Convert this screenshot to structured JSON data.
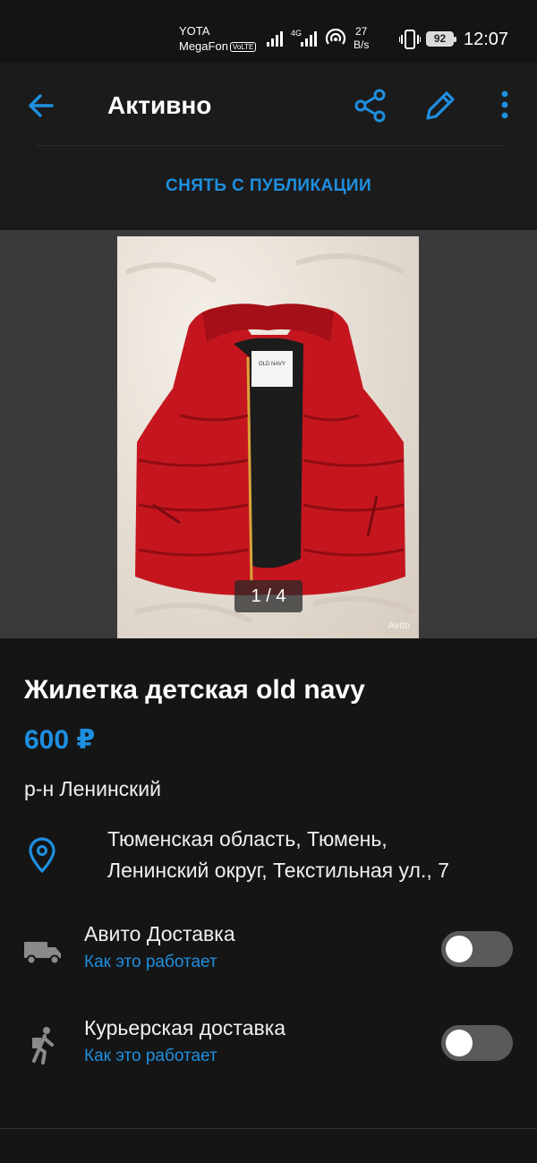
{
  "status_bar": {
    "carrier1": "YOTA",
    "carrier2": "MegaFon",
    "volte": "VoLTE",
    "network_type": "4G",
    "speed_value": "27",
    "speed_unit": "B/s",
    "battery": "92",
    "time": "12:07"
  },
  "toolbar": {
    "title": "Активно",
    "back_icon": "arrow-left-icon",
    "share_icon": "share-icon",
    "edit_icon": "pencil-icon",
    "more_icon": "more-vert-icon"
  },
  "unpublish_button": "СНЯТЬ С ПУБЛИКАЦИИ",
  "gallery": {
    "counter": "1 / 4",
    "watermark": "Avito",
    "tag_text": "OLD NAVY"
  },
  "listing": {
    "title": "Жилетка детская old navy",
    "price": "600 ₽",
    "district": "р-н Ленинский",
    "address_line1": "Тюменская область, Тюмень,",
    "address_line2": "Ленинский округ, Текстильная ул., 7"
  },
  "delivery": [
    {
      "title": "Авито Доставка",
      "link": "Как это работает",
      "icon": "truck-icon",
      "enabled": false
    },
    {
      "title": "Курьерская доставка",
      "link": "Как это работает",
      "icon": "courier-walking-icon",
      "enabled": false
    }
  ],
  "colors": {
    "accent": "#1e8fe0",
    "background": "#151515",
    "toolbar": "#1b1b1b",
    "toggle_off": "#5a5a5a"
  }
}
